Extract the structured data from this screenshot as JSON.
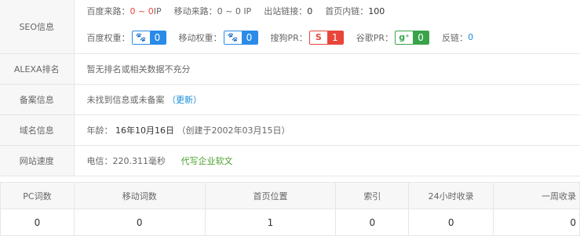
{
  "seo": {
    "label": "SEO信息",
    "baidu_traffic_label": "百度来路：",
    "baidu_traffic_value": "0 ~ 0",
    "baidu_traffic_unit": " IP",
    "mobile_traffic_label": "移动来路：",
    "mobile_traffic_value": "0 ~ 0 IP",
    "outbound_label": "出站链接：",
    "outbound_value": "0",
    "inbound_label": "首页内链：",
    "inbound_value": "100",
    "baidu_weight_label": "百度权重：",
    "baidu_weight_icon": "🐾",
    "baidu_weight_value": "0",
    "mobile_weight_label": "移动权重：",
    "mobile_weight_icon": "🐾",
    "mobile_weight_value": "0",
    "sogou_pr_label": "搜狗PR：",
    "sogou_pr_icon": "S",
    "sogou_pr_value": "1",
    "google_pr_label": "谷歌PR：",
    "google_pr_icon": "g⁺",
    "google_pr_value": "0",
    "backlinks_label": "反链：",
    "backlinks_value": "0"
  },
  "alexa": {
    "label": "ALEXA排名",
    "value": "暂无排名或相关数据不充分"
  },
  "icp": {
    "label": "备案信息",
    "value": "未找到信息或未备案",
    "update_link": "（更新）"
  },
  "domain": {
    "label": "域名信息",
    "age_label": "年龄：",
    "age_value": "16年10月16日",
    "created": "（创建于2002年03月15日）"
  },
  "speed": {
    "label": "网站速度",
    "value": "电信：220.311毫秒",
    "ad_link": "代写企业软文"
  },
  "stats": {
    "headers": [
      "PC词数",
      "移动词数",
      "首页位置",
      "索引",
      "24小时收录",
      "一周收录"
    ],
    "values": [
      "0",
      "0",
      "1",
      "0",
      "0",
      "0"
    ]
  },
  "colors": {
    "red": "#e8463b",
    "blue": "#2a8be8",
    "green": "#3aa34a",
    "link_blue": "#1a8cd8"
  }
}
